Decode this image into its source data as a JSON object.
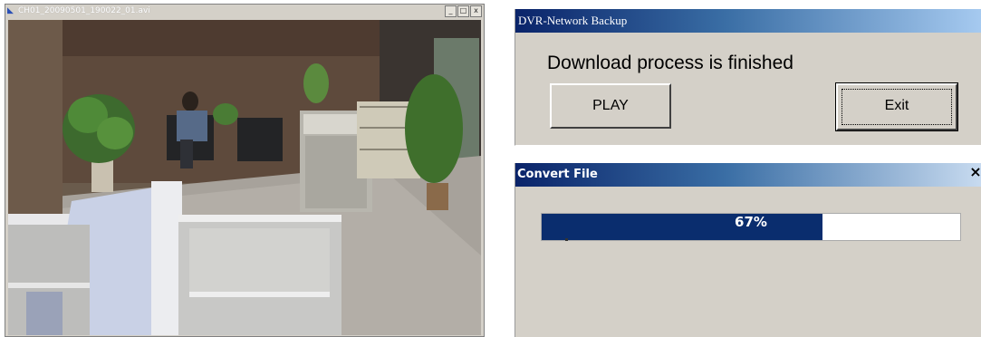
{
  "player": {
    "title": "CH01_20090501_190022_01.avi",
    "controls": {
      "minimize": "_",
      "maximize": "□",
      "close": "x"
    }
  },
  "dvr_dialog": {
    "title": "DVR-Network Backup",
    "message": "Download process is finished",
    "play_label": "PLAY",
    "exit_label": "Exit"
  },
  "convert_dialog": {
    "title": "Convert File",
    "close_label": "×",
    "progress_text": "67%",
    "progress_value": 0.67
  },
  "colors": {
    "titlebar_dark": "#0a246a",
    "progress_fill": "#0a2d6e",
    "dialog_bg": "#d4d0c8"
  }
}
